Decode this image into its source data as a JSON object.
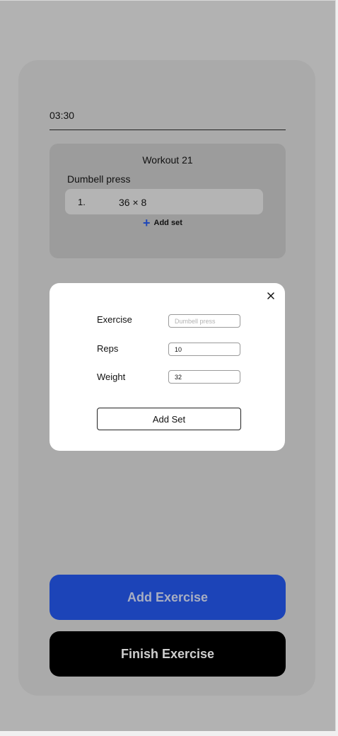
{
  "timer": {
    "value": "03:30"
  },
  "workout": {
    "title": "Workout 21",
    "exercise_name": "Dumbell press",
    "sets": [
      {
        "index": "1.",
        "value": "36 × 8"
      }
    ],
    "add_set_label": "Add set"
  },
  "modal": {
    "fields": [
      {
        "label": "Exercise",
        "value": "",
        "placeholder": "Dumbell press"
      },
      {
        "label": "Reps",
        "value": "10",
        "placeholder": ""
      },
      {
        "label": "Weight",
        "value": "32",
        "placeholder": ""
      }
    ],
    "submit_label": "Add Set",
    "close_icon": "close-icon"
  },
  "actions": {
    "add_exercise_label": "Add Exercise",
    "finish_exercise_label": "Finish Exercise"
  },
  "colors": {
    "accent_blue": "#1c44b8",
    "finish_black": "#000000",
    "overlay_gray": "#b2b2b2"
  }
}
